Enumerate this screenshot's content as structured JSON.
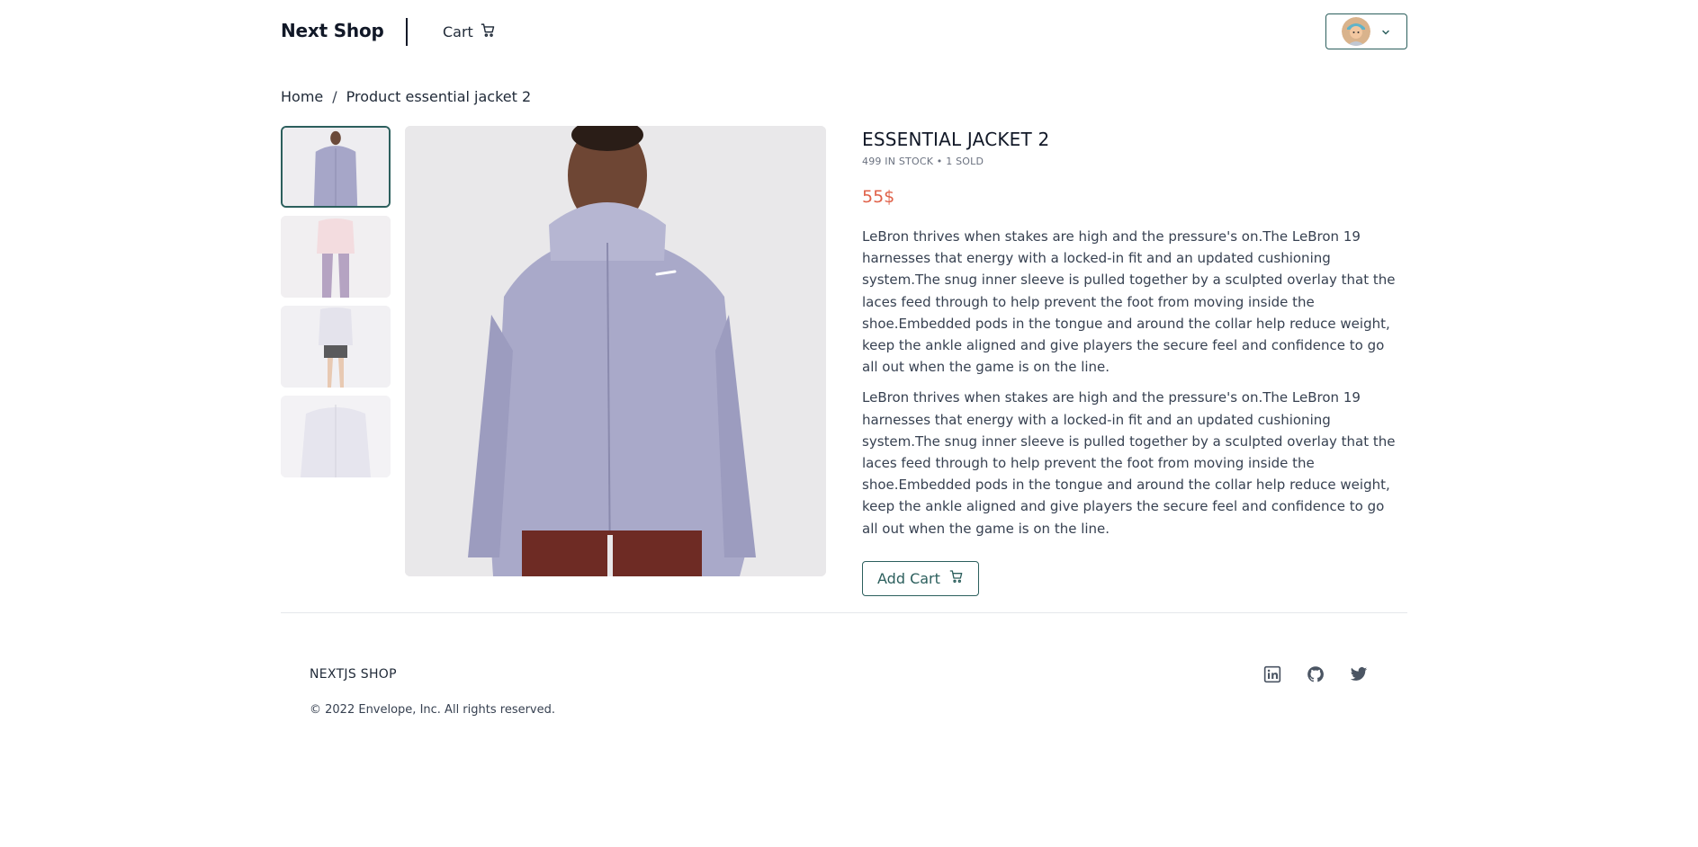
{
  "header": {
    "brand": "Next Shop",
    "cart_label": "Cart"
  },
  "breadcrumb": {
    "home": "Home",
    "separator": "/",
    "current": "Product essential jacket 2"
  },
  "product": {
    "title": "ESSENTIAL JACKET 2",
    "stock_line": "499 IN STOCK • 1 SOLD",
    "price": "55$",
    "description_1": "LeBron thrives when stakes are high and the pressure's on.The LeBron 19 harnesses that energy with a locked-in fit and an updated cushioning system.The snug inner sleeve is pulled together by a sculpted overlay that the laces feed through to help prevent the foot from moving inside the shoe.Embedded pods in the tongue and around the collar help reduce weight, keep the ankle aligned and give players the secure feel and confidence to go all out when the game is on the line.",
    "description_2": "LeBron thrives when stakes are high and the pressure's on.The LeBron 19 harnesses that energy with a locked-in fit and an updated cushioning system.The snug inner sleeve is pulled together by a sculpted overlay that the laces feed through to help prevent the foot from moving inside the shoe.Embedded pods in the tongue and around the collar help reduce weight, keep the ankle aligned and give players the secure feel and confidence to go all out when the game is on the line.",
    "add_cart_label": "Add Cart"
  },
  "footer": {
    "brand": "NEXTJS SHOP",
    "copyright": "© 2022 Envelope, Inc. All rights reserved.",
    "socials": [
      "linkedin-icon",
      "github-icon",
      "twitter-icon"
    ]
  },
  "colors": {
    "accent": "#2c5f5d",
    "price": "#e0624a"
  }
}
